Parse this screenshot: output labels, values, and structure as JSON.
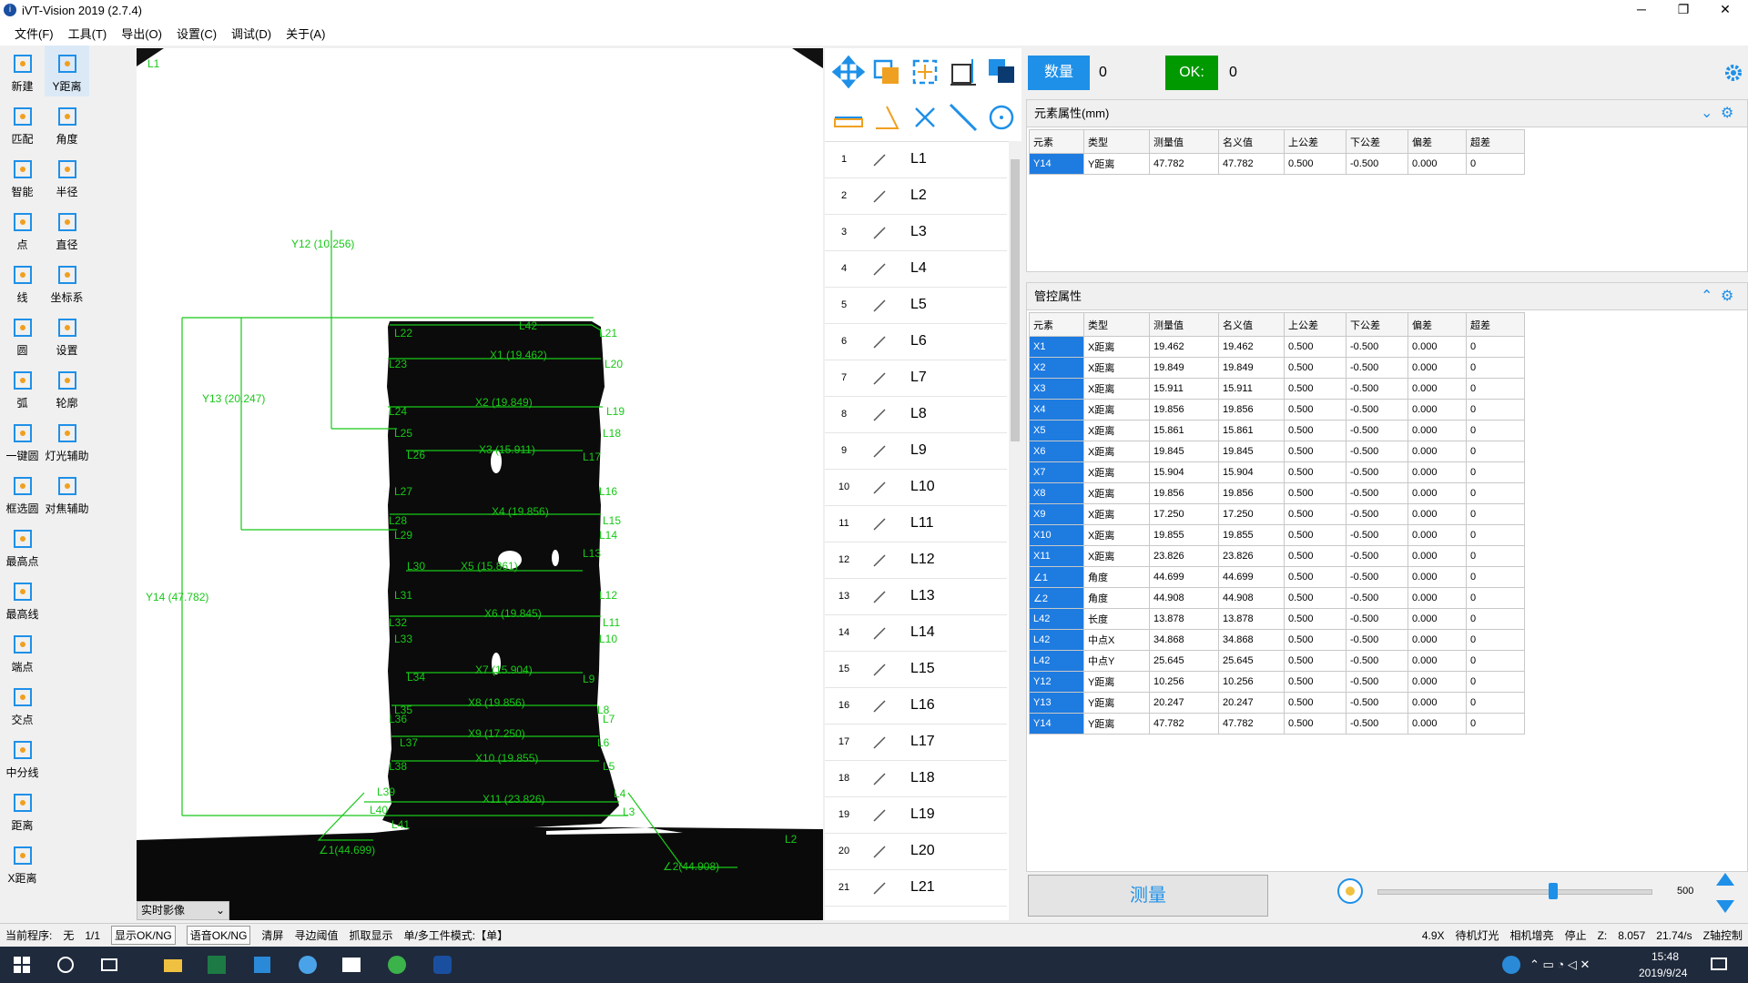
{
  "window": {
    "title": "iVT-Vision 2019 (2.7.4)",
    "minimize": "─",
    "maximize": "❐",
    "close": "✕"
  },
  "menu": [
    "文件(F)",
    "工具(T)",
    "导出(O)",
    "设置(C)",
    "调试(D)",
    "关于(A)"
  ],
  "tools": [
    {
      "label": "新建",
      "icon": "new-file-icon"
    },
    {
      "label": "Y距离",
      "icon": "y-distance-icon",
      "selected": true
    },
    {
      "label": "匹配",
      "icon": "match-icon"
    },
    {
      "label": "角度",
      "icon": "angle-icon"
    },
    {
      "label": "智能",
      "icon": "smart-icon"
    },
    {
      "label": "半径",
      "icon": "radius-icon"
    },
    {
      "label": "点",
      "icon": "point-icon"
    },
    {
      "label": "直径",
      "icon": "diameter-icon"
    },
    {
      "label": "线",
      "icon": "line-icon"
    },
    {
      "label": "坐标系",
      "icon": "coordinate-icon"
    },
    {
      "label": "圆",
      "icon": "circle-icon"
    },
    {
      "label": "设置",
      "icon": "gear-icon"
    },
    {
      "label": "弧",
      "icon": "arc-icon"
    },
    {
      "label": "轮廓",
      "icon": "contour-icon"
    },
    {
      "label": "一键圆",
      "icon": "one-click-circle-icon"
    },
    {
      "label": "灯光辅助",
      "icon": "light-assist-icon"
    },
    {
      "label": "框选圆",
      "icon": "box-select-circle-icon"
    },
    {
      "label": "对焦辅助",
      "icon": "focus-assist-icon"
    },
    {
      "label": "最高点",
      "icon": "highest-point-icon"
    },
    {
      "label": "最高线",
      "icon": "highest-line-icon"
    },
    {
      "label": "端点",
      "icon": "endpoint-icon"
    },
    {
      "label": "交点",
      "icon": "intersection-icon"
    },
    {
      "label": "中分线",
      "icon": "bisector-icon"
    },
    {
      "label": "距离",
      "icon": "distance-icon"
    },
    {
      "label": "X距离",
      "icon": "x-distance-icon"
    }
  ],
  "viewport": {
    "live_label": "实时影像",
    "labels": [
      "L1",
      "L2",
      "L21",
      "L22",
      "L23",
      "L20",
      "L24",
      "L19",
      "L25",
      "L18",
      "L26",
      "L17",
      "L27",
      "L16",
      "L28",
      "L15",
      "L29",
      "L14",
      "L13",
      "L30",
      "L31",
      "L12",
      "L32",
      "L11",
      "L33",
      "L10",
      "L34",
      "L9",
      "L35",
      "L8",
      "L36",
      "L7",
      "L37",
      "L6",
      "L38",
      "L5",
      "L39",
      "L4",
      "L40",
      "L3",
      "L41",
      "L42"
    ],
    "dims": {
      "x1": "X1 (19.462)",
      "x2": "X2 (19.849)",
      "x3": "X3 (15.911)",
      "x4": "X4 (19.856)",
      "x5": "X5 (15.861)",
      "x6": "X6 (19.845)",
      "x7": "X7 (15.904)",
      "x8": "X8 (19.856)",
      "x9": "X9 (17.250)",
      "x10": "X10 (19.855)",
      "x11": "X11 (23.826)",
      "y12": "Y12 (10.256)",
      "y13": "Y13 (20.247)",
      "y14": "Y14 (47.782)",
      "a1": "∠1(44.699)",
      "a2": "∠2(44.908)"
    }
  },
  "line_list": [
    "L1",
    "L2",
    "L3",
    "L4",
    "L5",
    "L6",
    "L7",
    "L8",
    "L9",
    "L10",
    "L11",
    "L12",
    "L13",
    "L14",
    "L15",
    "L16",
    "L17",
    "L18",
    "L19",
    "L20",
    "L21"
  ],
  "counters": {
    "qty_label": "数量",
    "qty_value": "0",
    "ok_label": "OK:",
    "ok_value": "0"
  },
  "element_panel": {
    "title": "元素属性(mm)",
    "headers": [
      "元素",
      "类型",
      "测量值",
      "名义值",
      "上公差",
      "下公差",
      "偏差",
      "超差"
    ],
    "rows": [
      [
        "Y14",
        "Y距离",
        "47.782",
        "47.782",
        "0.500",
        "-0.500",
        "0.000",
        "0"
      ]
    ]
  },
  "control_panel": {
    "title": "管控属性",
    "headers": [
      "元素",
      "类型",
      "测量值",
      "名义值",
      "上公差",
      "下公差",
      "偏差",
      "超差"
    ],
    "rows": [
      [
        "X1",
        "X距离",
        "19.462",
        "19.462",
        "0.500",
        "-0.500",
        "0.000",
        "0"
      ],
      [
        "X2",
        "X距离",
        "19.849",
        "19.849",
        "0.500",
        "-0.500",
        "0.000",
        "0"
      ],
      [
        "X3",
        "X距离",
        "15.911",
        "15.911",
        "0.500",
        "-0.500",
        "0.000",
        "0"
      ],
      [
        "X4",
        "X距离",
        "19.856",
        "19.856",
        "0.500",
        "-0.500",
        "0.000",
        "0"
      ],
      [
        "X5",
        "X距离",
        "15.861",
        "15.861",
        "0.500",
        "-0.500",
        "0.000",
        "0"
      ],
      [
        "X6",
        "X距离",
        "19.845",
        "19.845",
        "0.500",
        "-0.500",
        "0.000",
        "0"
      ],
      [
        "X7",
        "X距离",
        "15.904",
        "15.904",
        "0.500",
        "-0.500",
        "0.000",
        "0"
      ],
      [
        "X8",
        "X距离",
        "19.856",
        "19.856",
        "0.500",
        "-0.500",
        "0.000",
        "0"
      ],
      [
        "X9",
        "X距离",
        "17.250",
        "17.250",
        "0.500",
        "-0.500",
        "0.000",
        "0"
      ],
      [
        "X10",
        "X距离",
        "19.855",
        "19.855",
        "0.500",
        "-0.500",
        "0.000",
        "0"
      ],
      [
        "X11",
        "X距离",
        "23.826",
        "23.826",
        "0.500",
        "-0.500",
        "0.000",
        "0"
      ],
      [
        "∠1",
        "角度",
        "44.699",
        "44.699",
        "0.500",
        "-0.500",
        "0.000",
        "0"
      ],
      [
        "∠2",
        "角度",
        "44.908",
        "44.908",
        "0.500",
        "-0.500",
        "0.000",
        "0"
      ],
      [
        "L42",
        "长度",
        "13.878",
        "13.878",
        "0.500",
        "-0.500",
        "0.000",
        "0"
      ],
      [
        "L42",
        "中点X",
        "34.868",
        "34.868",
        "0.500",
        "-0.500",
        "0.000",
        "0"
      ],
      [
        "L42",
        "中点Y",
        "25.645",
        "25.645",
        "0.500",
        "-0.500",
        "0.000",
        "0"
      ],
      [
        "Y12",
        "Y距离",
        "10.256",
        "10.256",
        "0.500",
        "-0.500",
        "0.000",
        "0"
      ],
      [
        "Y13",
        "Y距离",
        "20.247",
        "20.247",
        "0.500",
        "-0.500",
        "0.000",
        "0"
      ],
      [
        "Y14",
        "Y距离",
        "47.782",
        "47.782",
        "0.500",
        "-0.500",
        "0.000",
        "0"
      ]
    ]
  },
  "measure_button": "测量",
  "slider": {
    "value": "500",
    "level": 0.64
  },
  "status": {
    "program_label": "当前程序:",
    "program": "无",
    "page": "1/1",
    "show_oknk": "显示OK/NG",
    "voice_oknk": "语音OK/NG",
    "clear": "清屏",
    "edge": "寻边阈值",
    "capture": "抓取显示",
    "mode": "单/多工件模式:【单】",
    "zoom": "4.9X",
    "light": "待机灯光",
    "camera": "相机增亮",
    "stop": "停止",
    "z_label": "Z:",
    "z_value": "8.057",
    "speed": "21.74/s",
    "zaxis": "Z轴控制"
  },
  "taskbar": {
    "time": "15:48",
    "date": "2019/9/24"
  },
  "colors": {
    "accent": "#1e90e8",
    "ok": "#009900",
    "measure": "#18c818"
  }
}
